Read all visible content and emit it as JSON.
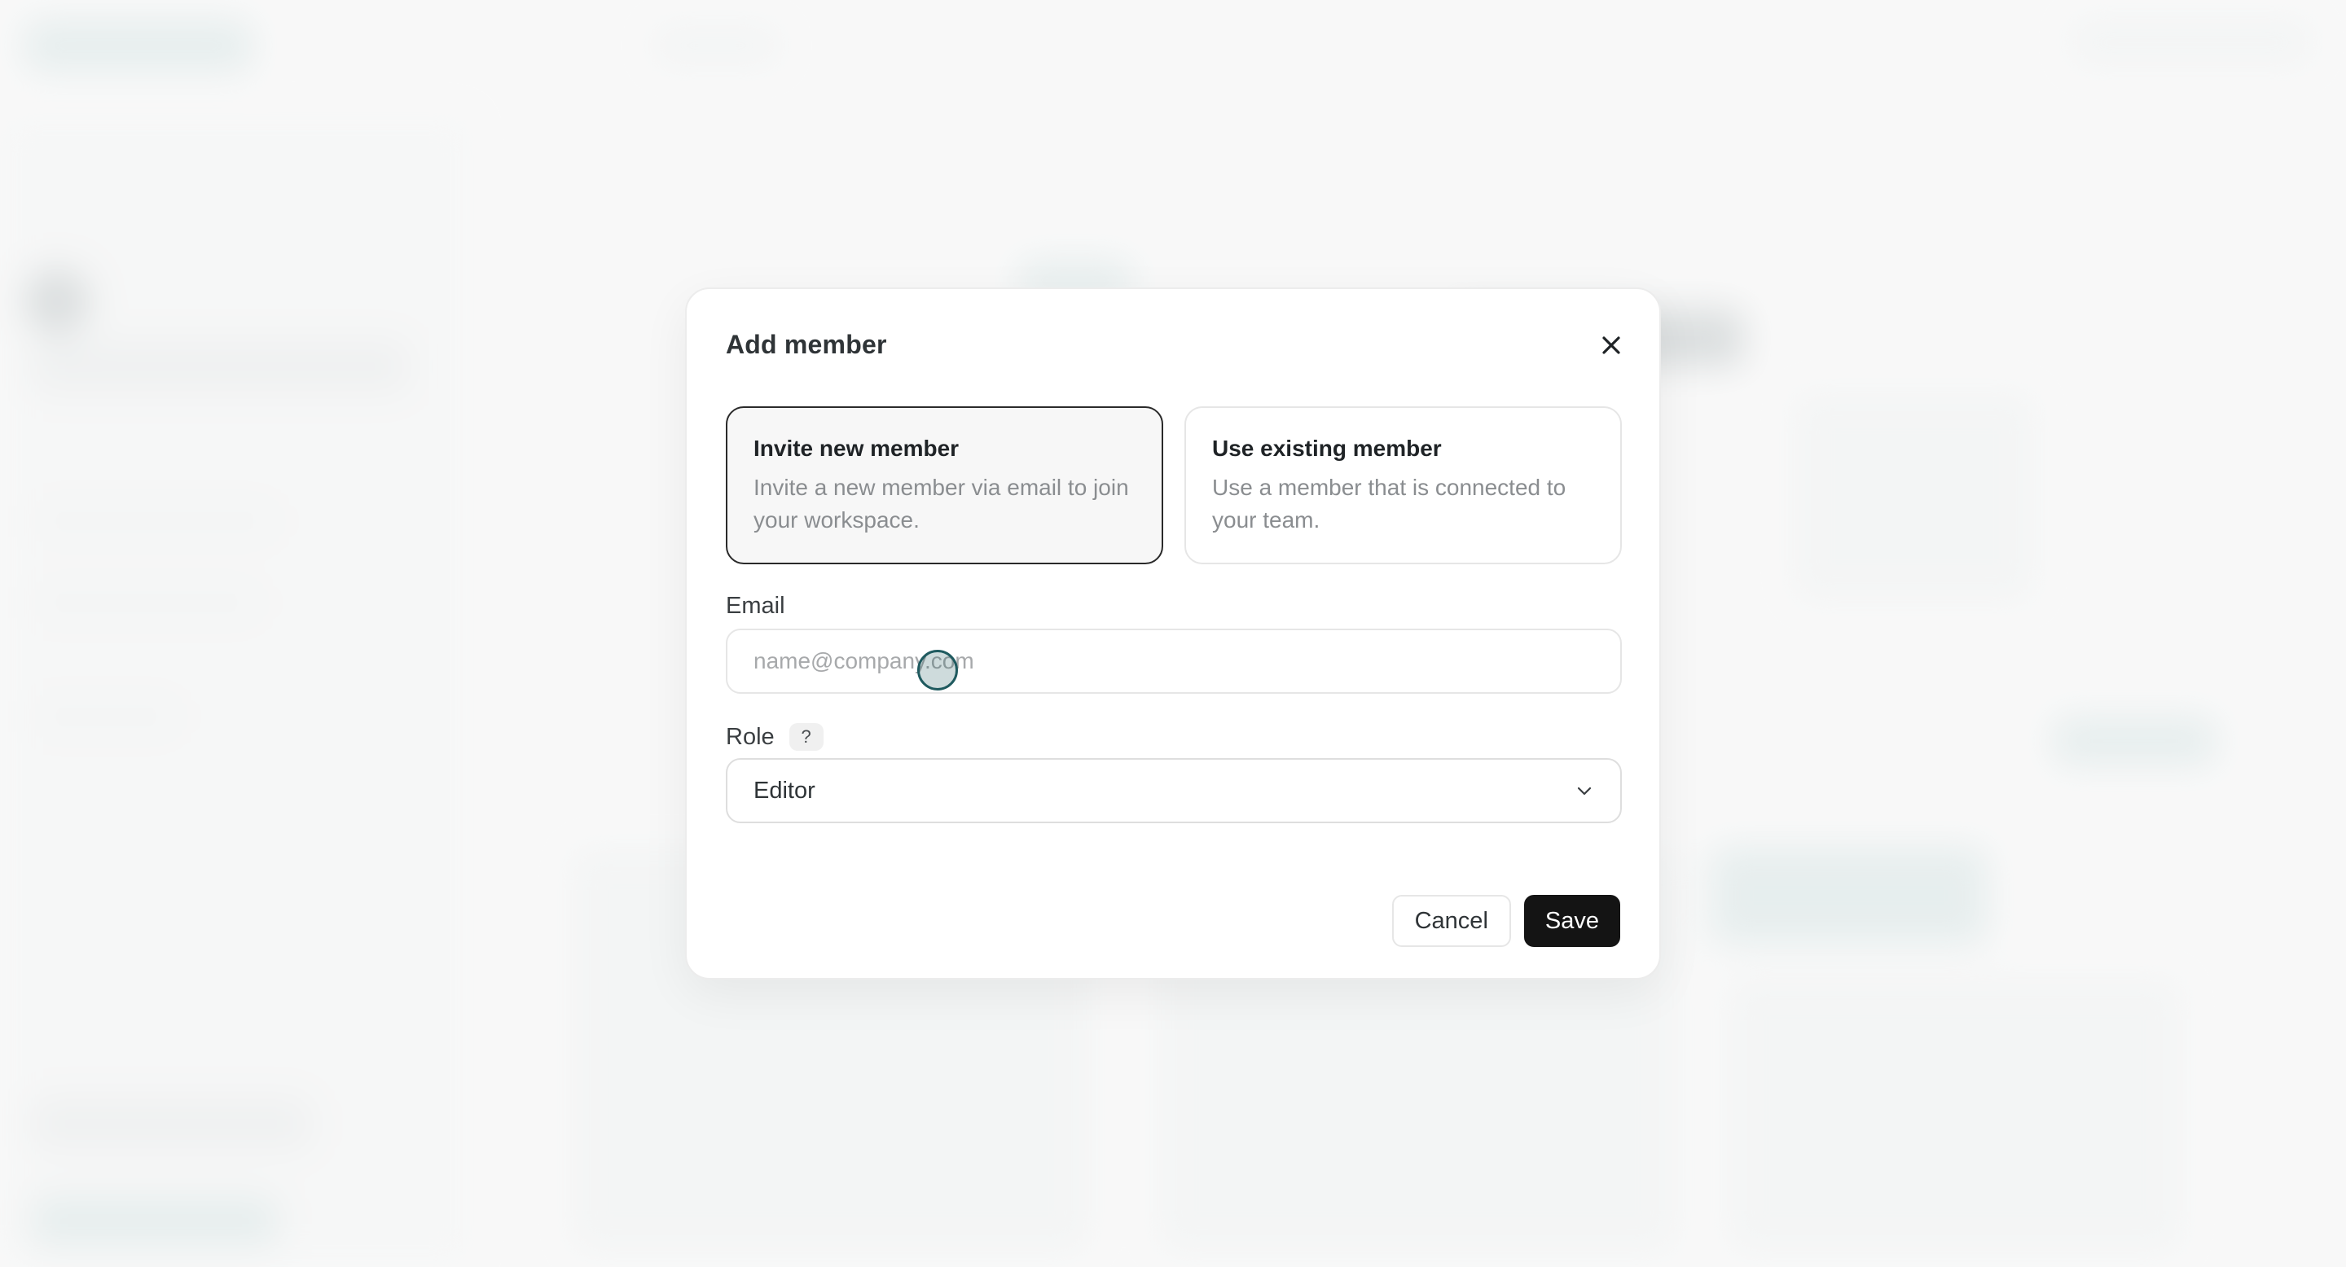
{
  "modal": {
    "title": "Add member",
    "close_icon": "close-icon",
    "options": [
      {
        "title": "Invite new member",
        "description": "Invite a new member via email to join your workspace.",
        "selected": true
      },
      {
        "title": "Use existing member",
        "description": "Use a member that is connected to your team.",
        "selected": false
      }
    ],
    "email": {
      "label": "Email",
      "value": "",
      "placeholder": "name@company.com"
    },
    "role": {
      "label": "Role",
      "help_badge": "?",
      "selected": "Editor",
      "chevron_icon": "chevron-down-icon"
    },
    "buttons": {
      "cancel": "Cancel",
      "save": "Save"
    }
  },
  "colors": {
    "primary_button": "#141414",
    "cursor_ring": "#1f5a5f",
    "selected_card_border": "#2a2a2a"
  }
}
